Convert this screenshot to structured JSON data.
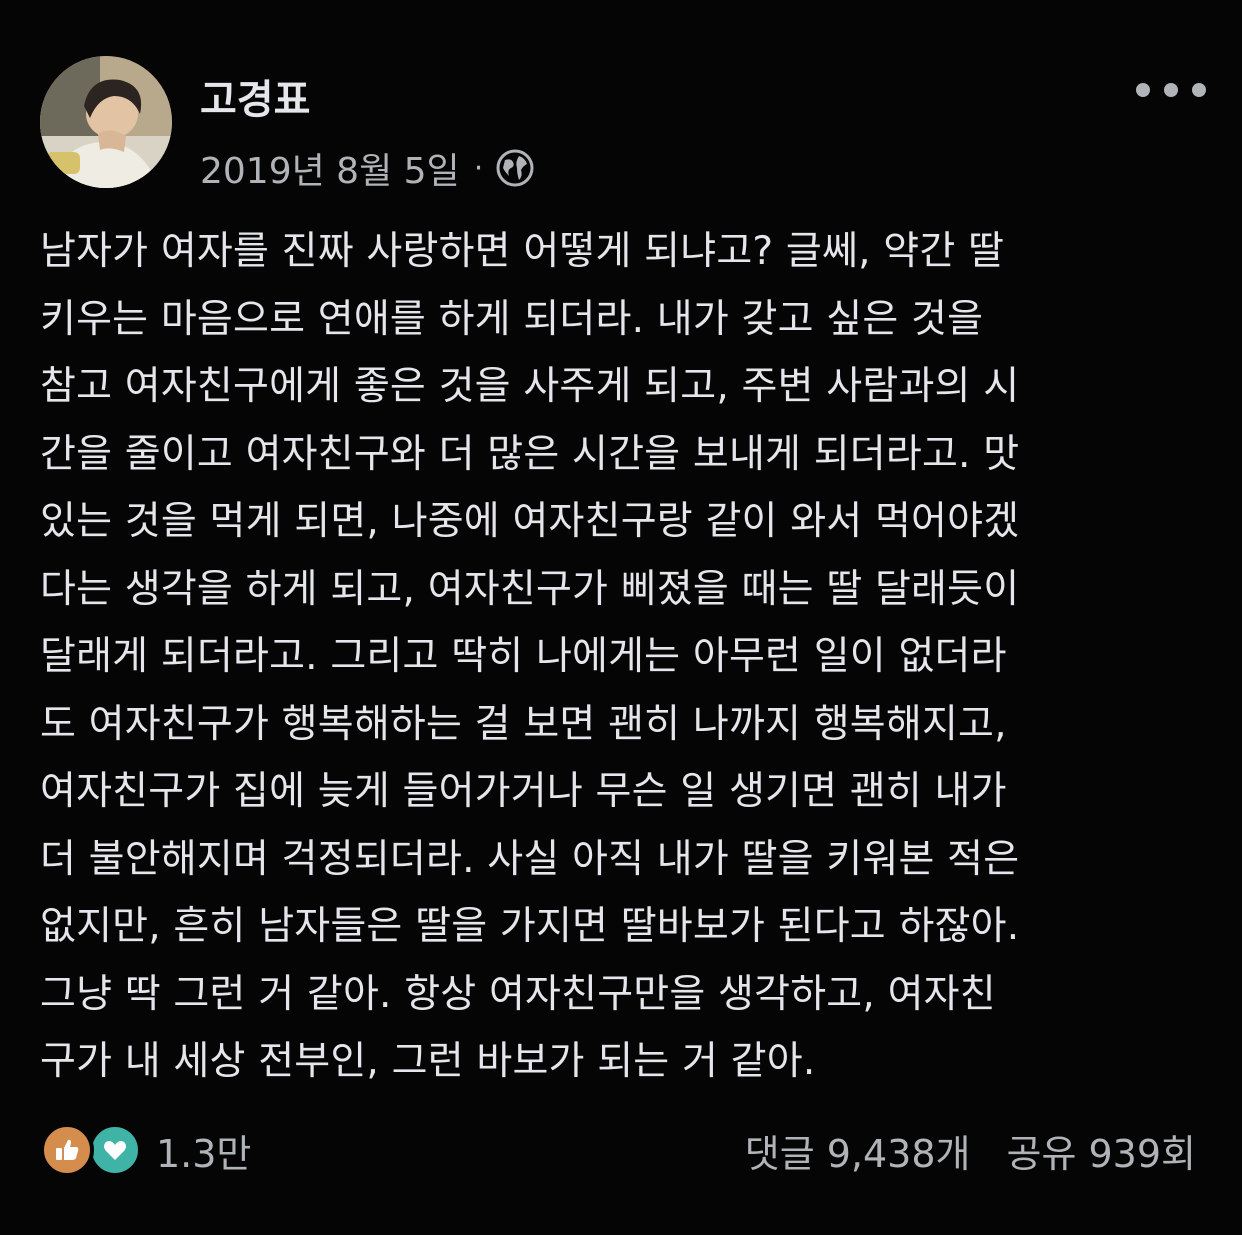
{
  "post": {
    "author": "고경표",
    "date": "2019년 8월 5일",
    "separator": "·",
    "privacy_icon": "globe-icon",
    "menu_icon": "more-horizontal-icon",
    "text_lines": [
      "남자가 여자를 진짜 사랑하면 어떻게 되냐고? 글쎄, 약간 딸",
      "키우는 마음으로 연애를 하게 되더라. 내가 갖고 싶은 것을",
      "참고 여자친구에게 좋은 것을 사주게 되고, 주변 사람과의 시",
      "간을 줄이고 여자친구와 더 많은 시간을 보내게 되더라고. 맛",
      "있는 것을 먹게 되면, 나중에 여자친구랑 같이 와서 먹어야겠",
      "다는 생각을 하게 되고, 여자친구가 삐졌을 때는 딸 달래듯이",
      "달래게 되더라고. 그리고 딱히 나에게는 아무런 일이 없더라",
      "도 여자친구가 행복해하는 걸 보면 괜히 나까지 행복해지고,",
      "여자친구가 집에 늦게 들어가거나 무슨 일 생기면 괜히 내가",
      "더 불안해지며 걱정되더라. 사실 아직 내가 딸을 키워본 적은",
      "없지만, 흔히 남자들은 딸을 가지면 딸바보가 된다고 하잖아.",
      "그냥 딱 그런 거 같아. 항상 여자친구만을 생각하고, 여자친",
      "구가 내 세상 전부인, 그런 바보가 되는 거 같아."
    ]
  },
  "footer": {
    "reaction_icons": [
      "like-icon",
      "love-icon"
    ],
    "reaction_count": "1.3만",
    "comments": "댓글 9,438개",
    "shares": "공유 939회"
  },
  "colors": {
    "background": "#050505",
    "primary_text": "#e4e6eb",
    "secondary_text": "#b0b3b8",
    "like": "#d58d4e",
    "love": "#3fb3a6"
  }
}
